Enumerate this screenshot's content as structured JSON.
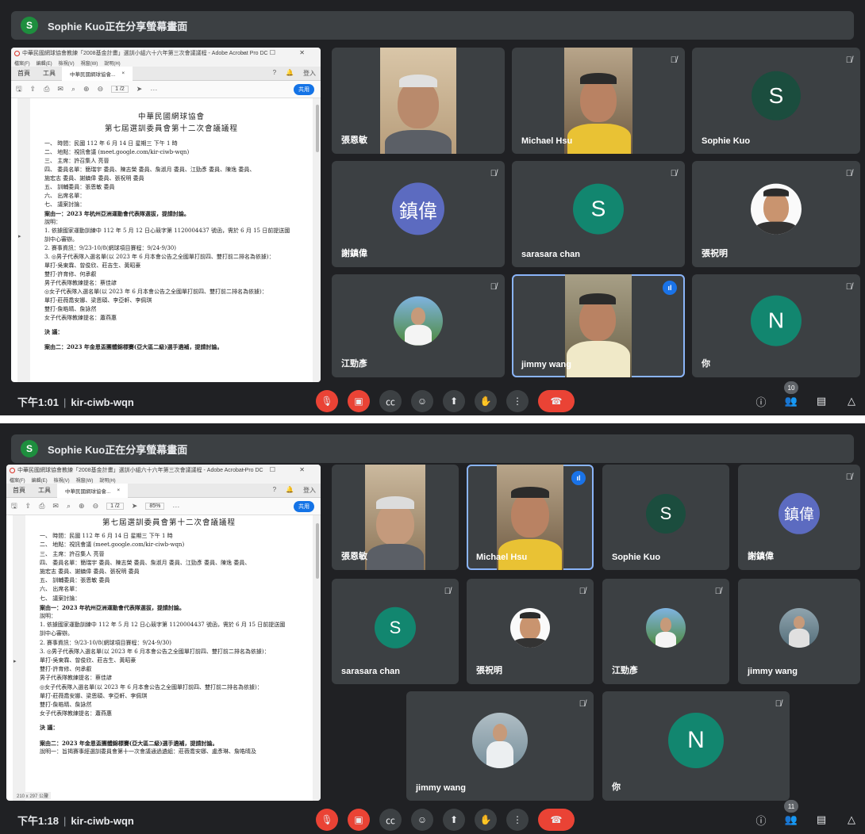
{
  "colors": {
    "bg": "#202124",
    "tile": "#3c4043",
    "end_call": "#ea4335",
    "accent": "#8ab4f8",
    "speaking": "#1a73e8"
  },
  "banner": {
    "avatar_letter": "S",
    "text": "Sophie Kuo正在分享螢幕畫面"
  },
  "acrobat": {
    "window_title": "中華民國網球協會教練「2008基金計畫」選訓小組六十六年第三次會議議程 - Adobe Acrobat Pro DC",
    "menu": [
      "檔案(F)",
      "編輯(E)",
      "檢視(V)",
      "視窗(W)",
      "說明(H)"
    ],
    "tabs": {
      "home": "首頁",
      "tools": "工具",
      "doc": "中華民國網球協會...",
      "close": "×"
    },
    "top_right": {
      "help": "?",
      "bell": "🔔",
      "login": "登入"
    },
    "toolbar": {
      "page1": "1 /2",
      "zoom2": "85%",
      "share": "共用"
    },
    "status2": "210 x 297 公釐"
  },
  "doc": {
    "org": "中華民國網球協會",
    "title": "第七屆選訓委員會第十二次會議議程",
    "lines": [
      "一、 時間：民國 112 年 6 月 14 日 星期三 下午 1 時",
      "二、 地點：視訊會議 (meet.google.com/kir-ciwb-wqn)",
      "三、 主席：許召集人 亮晉",
      "四、 委員名單：簡瑞宇 委員、陳志榮 委員、詹淑月 委員、江勁彥 委員、陳逸 委員、",
      "         施宏志 委員、謝鎮偉 委員、張祝明 委員",
      "五、 訓輔委員：張恩敏 委員",
      "六、 出席名單：",
      "七、 議案討論：",
      "案由一：2023 年杭州亞洲運動會代表隊選拔，提請討論。",
      "說明：",
      "  1. 依據國家運動訓練中 112 年 5 月 12 日心競字第 1120004437 號函，需於 6 月 15 日前提送國",
      "     訓中心審辦。",
      "  2. 賽事資訊：9/23-10/8(網球項目賽程：9/24-9/30)",
      "  3. ◎男子代表隊入選名單(以 2023 年 6 月本會公告之全國單打前四、雙打前二排名為依據)：",
      "     單打-吳東霖、曾俊欣、莊吉生、黃昭豪",
      "     雙打-許育修、何承叡",
      "     男子代表隊教練提名：蔡佳諺",
      "     ◎女子代表隊入選名單(以 2023 年 6 月本會公告之全國單打前四、雙打前二排名為依據)：",
      "     單打-莊薇喬安娜、梁恩碩、李亞軒、李佩琪",
      "     雙打-詹皓晴、詹詠然",
      "     女子代表隊教練提名：蕭燕惠"
    ],
    "decision": "決  議：",
    "case2": "案由二：2023 年金恩盃團體錦標賽(亞大區二級)選手遴補，提請討論。",
    "case2_note": "說明一：旨揭賽事經選訓委員會第十一次會議通過遴組：莊薇喬安娜、盧彥琳、詹皓晴及"
  },
  "shot1": {
    "tiles": [
      {
        "name": "張恩敏"
      },
      {
        "name": "Michael Hsu"
      },
      {
        "name": "Sophie Kuo",
        "avatar": "S"
      },
      {
        "name": "謝鎮偉",
        "avatar": "鎮偉"
      },
      {
        "name": "sarasara chan",
        "avatar": "S"
      },
      {
        "name": "張祝明"
      },
      {
        "name": "江勁彥"
      },
      {
        "name": "jimmy wang"
      },
      {
        "name": "你",
        "avatar": "N"
      }
    ],
    "time": "下午1:01",
    "code": "kir-ciwb-wqn",
    "people_count": "10"
  },
  "shot2": {
    "tiles": [
      {
        "name": "張恩敏"
      },
      {
        "name": "Michael Hsu"
      },
      {
        "name": "Sophie Kuo",
        "avatar": "S"
      },
      {
        "name": "謝鎮偉",
        "avatar": "鎮偉"
      },
      {
        "name": "sarasara chan",
        "avatar": "S"
      },
      {
        "name": "張祝明"
      },
      {
        "name": "江勁彥"
      },
      {
        "name": "jimmy wang"
      },
      {
        "name": "jimmy wang"
      },
      {
        "name": "你",
        "avatar": "N"
      }
    ],
    "time": "下午1:18",
    "code": "kir-ciwb-wqn",
    "people_count": "11"
  },
  "icons": {
    "mic_off": "mic-off-icon",
    "cam_off": "camera-off-icon",
    "cc": "captions-icon",
    "emoji": "emoji-icon",
    "present": "present-icon",
    "hand": "raise-hand-icon",
    "more": "more-icon",
    "end": "end-call-icon",
    "info": "info-icon",
    "people": "people-icon",
    "chat": "chat-icon",
    "activities": "activities-icon",
    "speaking": "speaking-icon"
  }
}
